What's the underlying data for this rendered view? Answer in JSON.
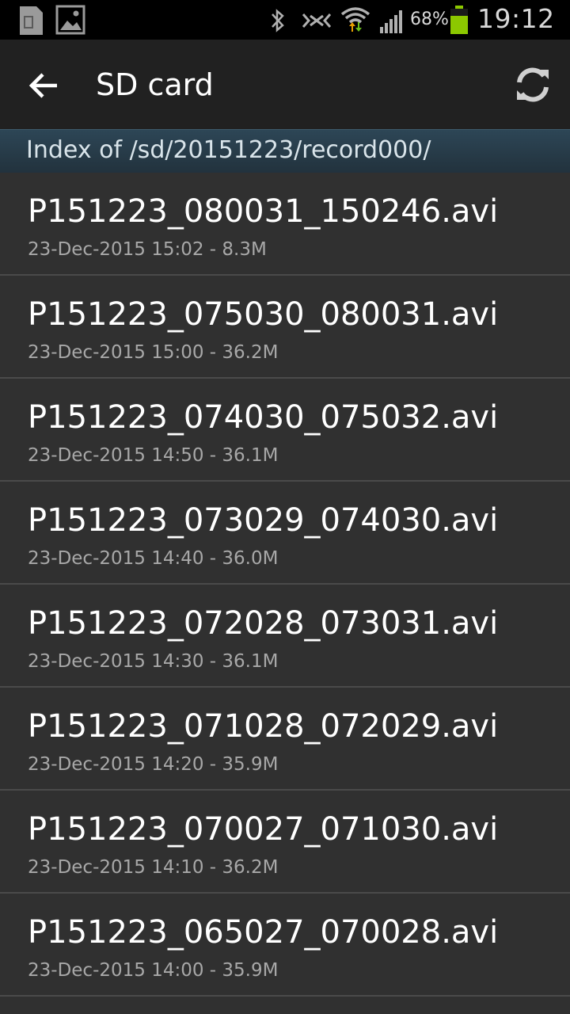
{
  "status_bar": {
    "battery_percent": "68%",
    "time": "19:12",
    "icons": [
      "sim-card-icon",
      "image-notification-icon",
      "bluetooth-icon",
      "nfc-icon",
      "wifi-icon",
      "signal-icon",
      "battery-icon"
    ],
    "battery_color": "#8cc800"
  },
  "action_bar": {
    "title": "SD card",
    "back_icon": "back-arrow-icon",
    "refresh_icon": "refresh-icon"
  },
  "path_header": {
    "text": "Index of /sd/20151223/record000/"
  },
  "files": [
    {
      "name": "P151223_080031_150246.avi",
      "meta": "23-Dec-2015 15:02 - 8.3M"
    },
    {
      "name": "P151223_075030_080031.avi",
      "meta": "23-Dec-2015 15:00 - 36.2M"
    },
    {
      "name": "P151223_074030_075032.avi",
      "meta": "23-Dec-2015 14:50 - 36.1M"
    },
    {
      "name": "P151223_073029_074030.avi",
      "meta": "23-Dec-2015 14:40 - 36.0M"
    },
    {
      "name": "P151223_072028_073031.avi",
      "meta": "23-Dec-2015 14:30 - 36.1M"
    },
    {
      "name": "P151223_071028_072029.avi",
      "meta": "23-Dec-2015 14:20 - 35.9M"
    },
    {
      "name": "P151223_070027_071030.avi",
      "meta": "23-Dec-2015 14:10 - 36.2M"
    },
    {
      "name": "P151223_065027_070028.avi",
      "meta": "23-Dec-2015 14:00 - 35.9M"
    }
  ]
}
